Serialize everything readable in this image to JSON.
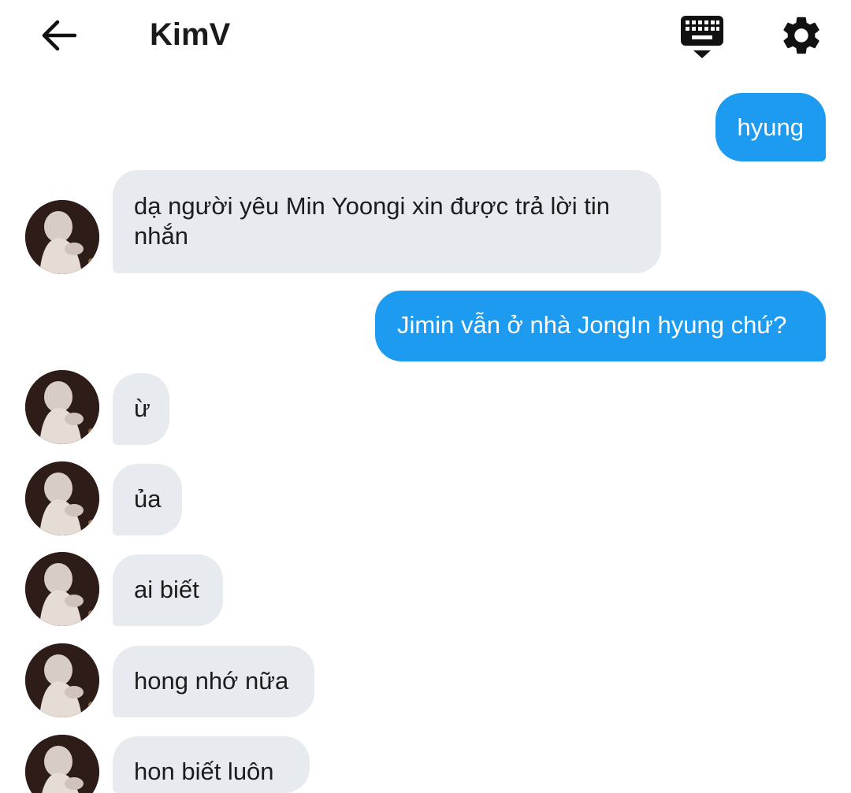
{
  "header": {
    "title": "KimV",
    "back_icon": "arrow-left-icon",
    "keyboard_icon": "keyboard-hide-icon",
    "settings_icon": "gear-icon"
  },
  "colors": {
    "outgoing_bubble": "#1d9bf0",
    "incoming_bubble": "#e7ebf0",
    "text_dark": "#1c1c1c"
  },
  "messages": [
    {
      "from": "me",
      "text": "hyung"
    },
    {
      "from": "them",
      "text": "dạ người yêu Min Yoongi xin được trả lời tin nhắn"
    },
    {
      "from": "me",
      "text": "Jimin vẫn ở nhà JongIn hyung chứ?"
    },
    {
      "from": "them",
      "text": "ừ"
    },
    {
      "from": "them",
      "text": "ủa"
    },
    {
      "from": "them",
      "text": "ai biết"
    },
    {
      "from": "them",
      "text": "hong nhớ nữa"
    },
    {
      "from": "them",
      "text": "hon biết luôn"
    }
  ]
}
